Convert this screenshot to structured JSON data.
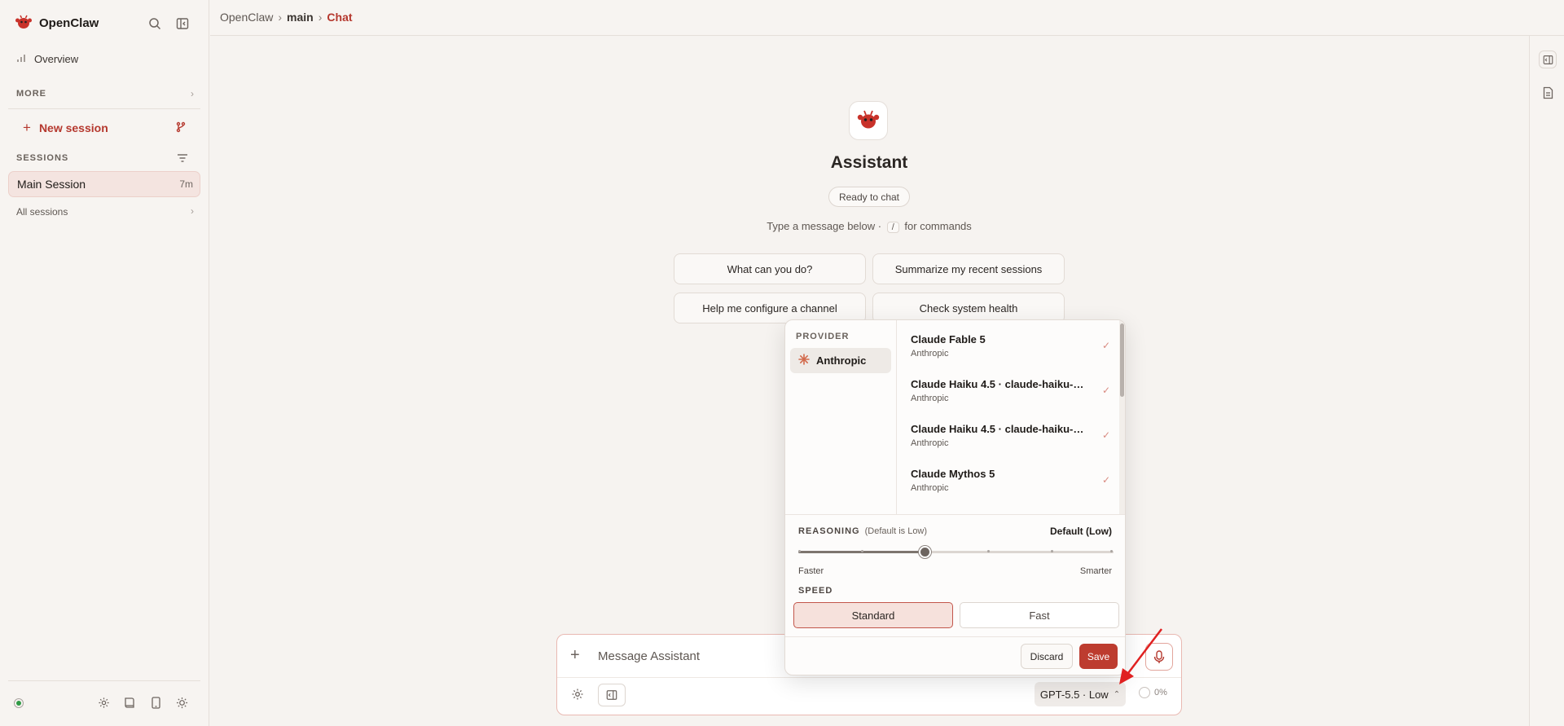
{
  "app": {
    "name": "OpenClaw",
    "accent": "#b5382e"
  },
  "sidebar": {
    "overview_label": "Overview",
    "more_label": "MORE",
    "new_session_label": "New session",
    "sessions_label": "SESSIONS",
    "sessions": [
      {
        "label": "Main Session",
        "age": "7m"
      }
    ],
    "all_sessions_label": "All sessions"
  },
  "breadcrumb": {
    "root": "OpenClaw",
    "middle": "main",
    "current": "Chat",
    "separator": "›"
  },
  "center": {
    "title": "Assistant",
    "status": "Ready to chat",
    "hint_before": "Type a message below ·",
    "hint_key": "/",
    "hint_after": "for commands",
    "suggestions": [
      "What can you do?",
      "Summarize my recent sessions",
      "Help me configure a channel",
      "Check system health"
    ]
  },
  "composer": {
    "placeholder": "Message Assistant",
    "model_label": "GPT-5.5 · Low",
    "context_percent": "0%"
  },
  "model_picker": {
    "provider_label": "PROVIDER",
    "provider_selected": "Anthropic",
    "models": [
      {
        "name": "Claude Fable 5",
        "provider": "Anthropic"
      },
      {
        "name": "Claude Haiku 4.5 · claude-haiku-4-...",
        "provider": "Anthropic"
      },
      {
        "name": "Claude Haiku 4.5 · claude-haiku-4-...",
        "provider": "Anthropic"
      },
      {
        "name": "Claude Mythos 5",
        "provider": "Anthropic"
      }
    ],
    "reasoning_label": "REASONING",
    "reasoning_hint": "(Default is Low)",
    "reasoning_value": "Default (Low)",
    "reasoning_level_fraction": 0.4,
    "slider_min_label": "Faster",
    "slider_max_label": "Smarter",
    "speed_label": "SPEED",
    "speed_options": [
      "Standard",
      "Fast"
    ],
    "speed_selected": "Standard",
    "discard_label": "Discard",
    "save_label": "Save"
  }
}
